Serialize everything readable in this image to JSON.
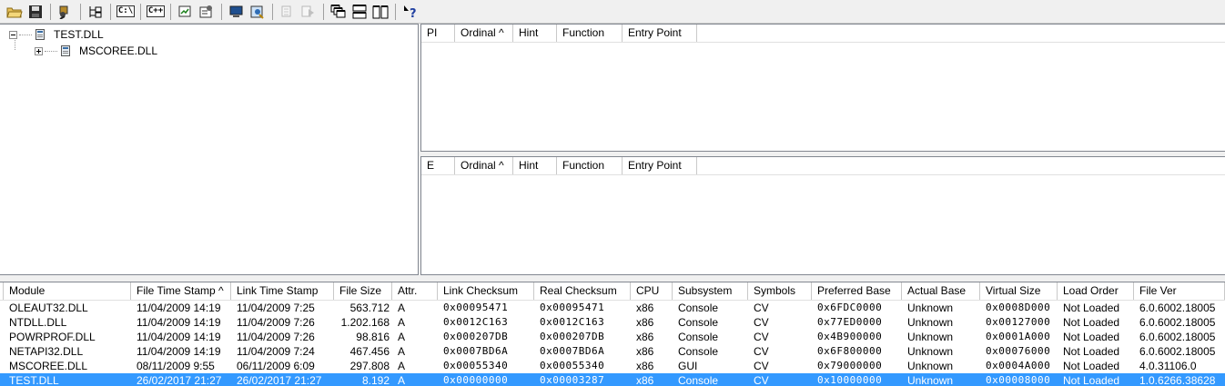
{
  "toolbar": {
    "cpath_label": "C:\\",
    "cpp_label": "C++"
  },
  "tree": {
    "root": "TEST.DLL",
    "child": "MSCOREE.DLL"
  },
  "imports": {
    "columns": [
      "PI",
      "Ordinal ^",
      "Hint",
      "Function",
      "Entry Point"
    ]
  },
  "exports": {
    "columns": [
      "E",
      "Ordinal ^",
      "Hint",
      "Function",
      "Entry Point"
    ]
  },
  "modules": {
    "columns": [
      "Module",
      "File Time Stamp ^",
      "Link Time Stamp",
      "File Size",
      "Attr.",
      "Link Checksum",
      "Real Checksum",
      "CPU",
      "Subsystem",
      "Symbols",
      "Preferred Base",
      "Actual Base",
      "Virtual Size",
      "Load Order",
      "File Ver"
    ],
    "rows": [
      [
        "OLEAUT32.DLL",
        "11/04/2009 14:19",
        "11/04/2009   7:25",
        "563.712",
        "A",
        "0x00095471",
        "0x00095471",
        "x86",
        "Console",
        "CV",
        "0x6FDC0000",
        "Unknown",
        "0x0008D000",
        "Not Loaded",
        "6.0.6002.18005"
      ],
      [
        "NTDLL.DLL",
        "11/04/2009 14:19",
        "11/04/2009   7:26",
        "1.202.168",
        "A",
        "0x0012C163",
        "0x0012C163",
        "x86",
        "Console",
        "CV",
        "0x77ED0000",
        "Unknown",
        "0x00127000",
        "Not Loaded",
        "6.0.6002.18005"
      ],
      [
        "POWRPROF.DLL",
        "11/04/2009 14:19",
        "11/04/2009   7:26",
        "98.816",
        "A",
        "0x000207DB",
        "0x000207DB",
        "x86",
        "Console",
        "CV",
        "0x4B900000",
        "Unknown",
        "0x0001A000",
        "Not Loaded",
        "6.0.6002.18005"
      ],
      [
        "NETAPI32.DLL",
        "11/04/2009 14:19",
        "11/04/2009   7:24",
        "467.456",
        "A",
        "0x0007BD6A",
        "0x0007BD6A",
        "x86",
        "Console",
        "CV",
        "0x6F800000",
        "Unknown",
        "0x00076000",
        "Not Loaded",
        "6.0.6002.18005"
      ],
      [
        "MSCOREE.DLL",
        "08/11/2009   9:55",
        "06/11/2009   6:09",
        "297.808",
        "A",
        "0x00055340",
        "0x00055340",
        "x86",
        "GUI",
        "CV",
        "0x79000000",
        "Unknown",
        "0x0004A000",
        "Not Loaded",
        "4.0.31106.0"
      ],
      [
        "TEST.DLL",
        "26/02/2017 21:27",
        "26/02/2017 21:27",
        "8.192",
        "A",
        "0x00000000",
        "0x00003287",
        "x86",
        "Console",
        "CV",
        "0x10000000",
        "Unknown",
        "0x00008000",
        "Not Loaded",
        "1.0.6266.38628"
      ]
    ],
    "selected_index": 5
  },
  "colors": {
    "selection": "#3399ff",
    "toolbar_bg": "#f0f0f0"
  },
  "icons": [
    "open-folder-icon",
    "save-icon",
    "find-icon",
    "hierarchy-icon",
    "full-paths-icon",
    "undecorate-cpp-icon",
    "autoexpand-icon",
    "properties-icon",
    "system-info-icon",
    "view-module-icon",
    "copy-icon",
    "external-viewer-icon",
    "cascade-icon",
    "tile-horizontal-icon",
    "tile-vertical-icon",
    "help-icon"
  ]
}
